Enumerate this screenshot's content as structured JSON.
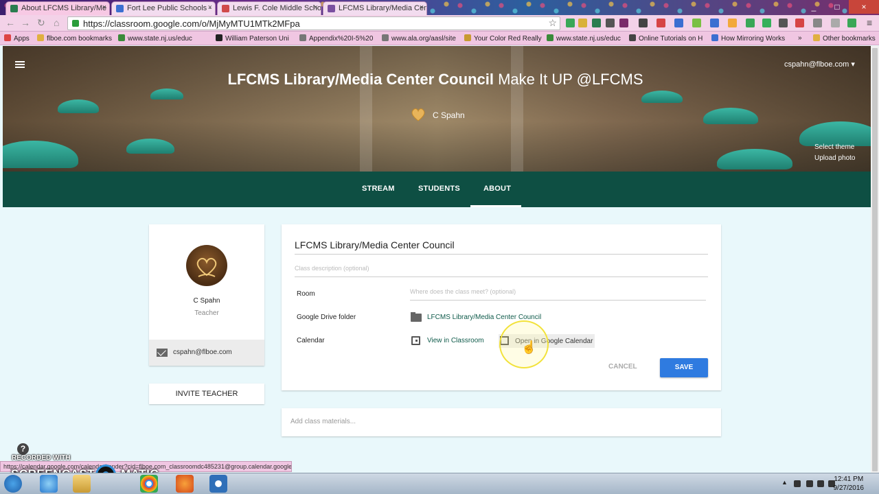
{
  "browser": {
    "tabs": [
      {
        "title": "About LFCMS Library/Me",
        "icon_color": "#2a7d4f",
        "active": true
      },
      {
        "title": "Fort Lee Public Schools -",
        "icon_color": "#3b6fd1",
        "active": false
      },
      {
        "title": "Lewis F. Cole Middle Scho",
        "icon_color": "#d04a4a",
        "active": false
      },
      {
        "title": "LFCMS Library/Media Cen",
        "icon_color": "#7a4fa0",
        "active": false
      }
    ],
    "url": "https://classroom.google.com/o/MjMyMTU1MTk2MFpa",
    "bookmarks": [
      {
        "label": "Apps"
      },
      {
        "label": "flboe.com bookmarks"
      },
      {
        "label": "www.state.nj.us/educ"
      },
      {
        "label": "William Paterson Uni"
      },
      {
        "label": "Appendix%20I-5%20"
      },
      {
        "label": "www.ala.org/aasl/site"
      },
      {
        "label": "Your Color Red Really"
      },
      {
        "label": "www.state.nj.us/educ"
      },
      {
        "label": "Online Tutorials on H"
      },
      {
        "label": "How Mirroring Works"
      },
      {
        "label": "»"
      },
      {
        "label": "Other bookmarks"
      }
    ],
    "tab_close": "×",
    "star": "☆",
    "window_controls": {
      "min": "_",
      "max": "□",
      "close": "×"
    }
  },
  "header": {
    "menu_icon": "hamburger-menu-icon",
    "class_name": "LFCMS Library/Media Center Council",
    "class_section": "Make It UP @LFCMS",
    "teacher": "C Spahn",
    "account": "cspahn@flboe.com ▾",
    "select_theme": "Select theme",
    "upload_photo": "Upload photo"
  },
  "nav": {
    "tabs": [
      "STREAM",
      "STUDENTS",
      "ABOUT"
    ],
    "active": "ABOUT"
  },
  "profile": {
    "name": "C Spahn",
    "role": "Teacher",
    "email": "cspahn@flboe.com",
    "invite": "INVITE TEACHER"
  },
  "about": {
    "class_name": "LFCMS Library/Media Center Council",
    "description_placeholder": "Class description (optional)",
    "room_label": "Room",
    "room_placeholder": "Where does the class meet? (optional)",
    "drive_label": "Google Drive folder",
    "drive_folder": "LFCMS Library/Media Center Council",
    "calendar_label": "Calendar",
    "view_in_classroom": "View in Classroom",
    "open_in_gcal": "Open in Google Calendar",
    "cancel": "CANCEL",
    "save": "SAVE"
  },
  "materials_placeholder": "Add class materials...",
  "status_url": "https://calendar.google.com/calendar/render?cid=flboe.com_classroomdc485231@group.calendar.google...",
  "recorder": {
    "help": "?",
    "recorded_with": "RECORDED WITH",
    "brand_left": "SCREENCAST",
    "brand_right": "MATIC"
  },
  "clock": {
    "time": "12:41 PM",
    "date": "9/27/2016"
  },
  "colors": {
    "nav_bg": "#0e4f43",
    "save": "#2f7be0",
    "page_bg": "#e9f8fb"
  }
}
